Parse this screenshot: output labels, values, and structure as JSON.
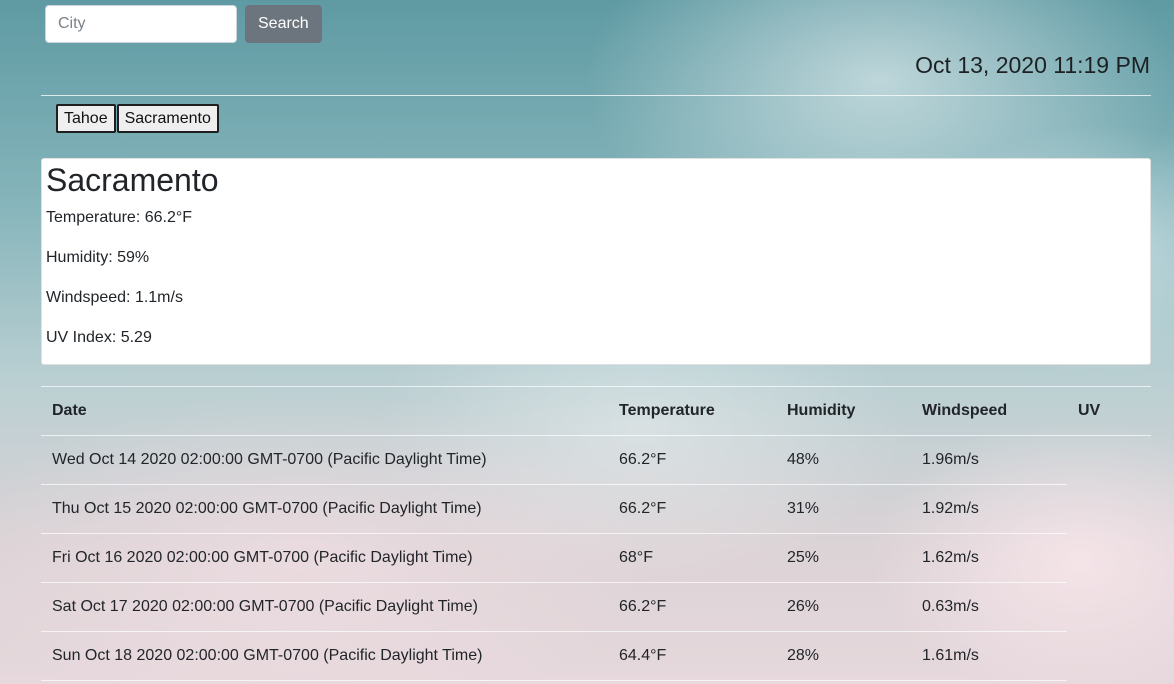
{
  "search": {
    "placeholder": "City",
    "value": "",
    "button_label": "Search"
  },
  "datetime": "Oct 13, 2020 11:19 PM",
  "history": [
    "Tahoe",
    "Sacramento"
  ],
  "current": {
    "city": "Sacramento",
    "temperature": "Temperature: 66.2°F",
    "humidity": "Humidity: 59%",
    "windspeed": "Windspeed: 1.1m/s",
    "uv_index": "UV Index: 5.29"
  },
  "forecast": {
    "headers": [
      "Date",
      "Temperature",
      "Humidity",
      "Windspeed",
      "UV"
    ],
    "rows": [
      {
        "date": "Wed Oct 14 2020 02:00:00 GMT-0700 (Pacific Daylight Time)",
        "temp": "66.2°F",
        "humidity": "48%",
        "wind": "1.96m/s",
        "uv": ""
      },
      {
        "date": "Thu Oct 15 2020 02:00:00 GMT-0700 (Pacific Daylight Time)",
        "temp": "66.2°F",
        "humidity": "31%",
        "wind": "1.92m/s",
        "uv": ""
      },
      {
        "date": "Fri Oct 16 2020 02:00:00 GMT-0700 (Pacific Daylight Time)",
        "temp": "68°F",
        "humidity": "25%",
        "wind": "1.62m/s",
        "uv": ""
      },
      {
        "date": "Sat Oct 17 2020 02:00:00 GMT-0700 (Pacific Daylight Time)",
        "temp": "66.2°F",
        "humidity": "26%",
        "wind": "0.63m/s",
        "uv": ""
      },
      {
        "date": "Sun Oct 18 2020 02:00:00 GMT-0700 (Pacific Daylight Time)",
        "temp": "64.4°F",
        "humidity": "28%",
        "wind": "1.61m/s",
        "uv": ""
      }
    ]
  },
  "colors": {
    "search_button": "#6c757d",
    "card_background": "#ffffff",
    "history_button": "#efefef"
  }
}
